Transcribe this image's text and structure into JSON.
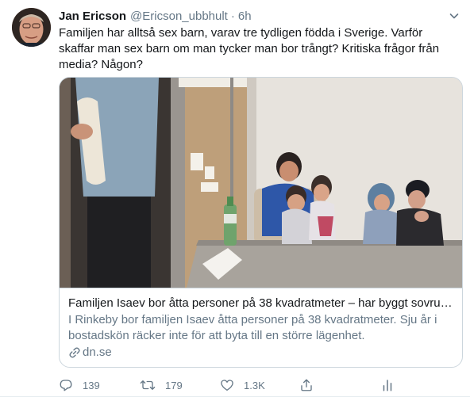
{
  "tweet": {
    "author_name": "Jan Ericson",
    "author_handle": "@Ericson_ubbhult",
    "separator": "·",
    "time": "6h",
    "text": "Familjen har alltså sex barn, varav tre tydligen födda i Sverige. Varför skaffar man sex barn om man tycker man bor trångt? Kritiska frågor från media? Någon?"
  },
  "card": {
    "title": "Familjen Isaev bor åtta personer på 38 kvadratmeter – har byggt sovru…",
    "description": "I Rinkeby bor familjen Isaev åtta personer på 38 kvadratmeter. Sju år i bostadskön räcker inte för att byta till en större lägenhet.",
    "domain": "dn.se"
  },
  "actions": {
    "reply_count": "139",
    "retweet_count": "179",
    "like_count": "1.3K"
  },
  "icons": {
    "caret": "chevron-down-icon",
    "reply": "reply-icon",
    "retweet": "retweet-icon",
    "like": "heart-icon",
    "share": "share-icon",
    "analytics": "analytics-icon",
    "link": "link-icon"
  },
  "colors": {
    "text": "#14171a",
    "secondary": "#657786",
    "border": "#ccd6dd"
  }
}
